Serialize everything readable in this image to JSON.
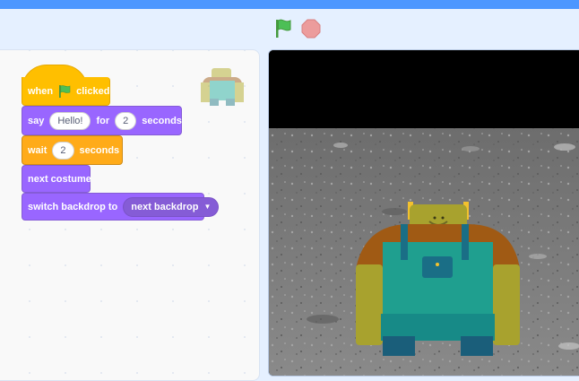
{
  "controls": {
    "green_flag_icon": "green-flag-icon",
    "stop_icon": "stop-sign-icon"
  },
  "script": {
    "hat": {
      "when": "when",
      "clicked": "clicked"
    },
    "say": {
      "label": "say",
      "message": "Hello!",
      "for": "for",
      "duration": "2",
      "unit": "seconds"
    },
    "wait": {
      "label": "wait",
      "duration": "2",
      "unit": "seconds"
    },
    "next_costume": {
      "label": "next costume"
    },
    "switch_backdrop": {
      "label": "switch backdrop to",
      "option": "next backdrop"
    }
  },
  "colors": {
    "events": "#ffbf00",
    "looks": "#9966ff",
    "control": "#ffab19",
    "accent": "#4c97ff"
  }
}
